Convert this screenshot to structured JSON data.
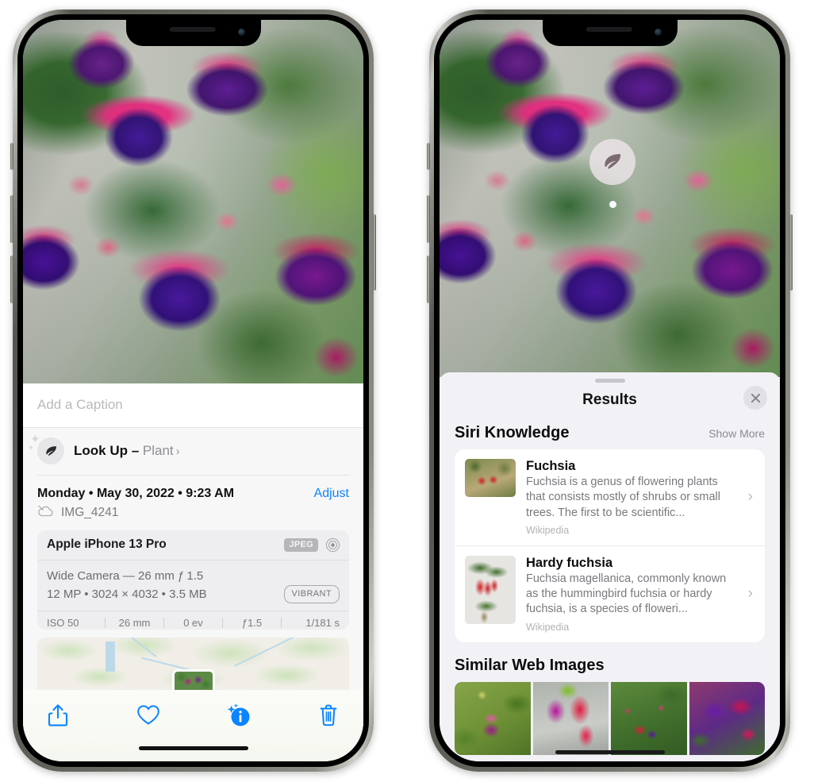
{
  "left_phone": {
    "caption_placeholder": "Add a Caption",
    "lookup": {
      "label": "Look Up –",
      "subject": "Plant",
      "chevron": "›",
      "icon": "leaf-icon"
    },
    "date": "Monday • May 30, 2022 • 9:23 AM",
    "adjust_label": "Adjust",
    "file_name": "IMG_4241",
    "cloud_icon": "icloud-slash-icon",
    "camera": {
      "device": "Apple iPhone 13 Pro",
      "format_badge": "JPEG",
      "lens_icon": "aperture-icon",
      "lens_line": "Wide Camera — 26 mm ƒ 1.5",
      "specs_line": "12 MP • 3024 × 4032 • 3.5 MB",
      "style_badge": "VIBRANT",
      "exif": [
        "ISO 50",
        "26 mm",
        "0 ev",
        "ƒ1.5",
        "1/181 s"
      ]
    },
    "toolbar": [
      {
        "name": "share-button",
        "icon": "share-icon"
      },
      {
        "name": "favorite-button",
        "icon": "heart-icon"
      },
      {
        "name": "info-button",
        "icon": "info-sparkle-icon"
      },
      {
        "name": "delete-button",
        "icon": "trash-icon"
      }
    ],
    "accent_color": "#0a84ff"
  },
  "right_phone": {
    "badge_icon": "leaf-icon",
    "sheet": {
      "title": "Results",
      "close_icon": "close-icon",
      "siri_knowledge": {
        "heading": "Siri Knowledge",
        "action": "Show More",
        "cards": [
          {
            "title": "Fuchsia",
            "description": "Fuchsia is a genus of flowering plants that consists mostly of shrubs or small trees. The first to be scientific...",
            "source": "Wikipedia",
            "chevron": "›"
          },
          {
            "title": "Hardy fuchsia",
            "description": "Fuchsia magellanica, commonly known as the hummingbird fuchsia or hardy fuchsia, is a species of floweri...",
            "source": "Wikipedia",
            "chevron": "›"
          }
        ]
      },
      "similar_web_images": {
        "heading": "Similar Web Images",
        "count": 4
      }
    }
  }
}
